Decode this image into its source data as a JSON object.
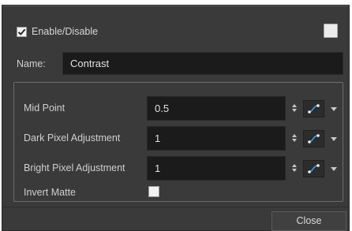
{
  "header": {
    "enable_label": "Enable/Disable",
    "enable_checked": true
  },
  "name_field": {
    "label": "Name:",
    "value": "Contrast"
  },
  "params": [
    {
      "label": "Mid Point",
      "value": "0.5"
    },
    {
      "label": "Dark Pixel Adjustment",
      "value": "1"
    },
    {
      "label": "Bright Pixel Adjustment",
      "value": "1"
    }
  ],
  "invert_matte": {
    "label": "Invert Matte",
    "checked": false
  },
  "footer": {
    "close_label": "Close"
  },
  "colors": {
    "window_bg": "#3a3a3a",
    "field_bg": "#1b1b1b",
    "function_icon_accent": "#3aa0e0"
  },
  "icons": {
    "function_button": "function-curve-icon",
    "spin": "spinner-arrows-icon",
    "dropdown": "chevron-down-icon"
  }
}
